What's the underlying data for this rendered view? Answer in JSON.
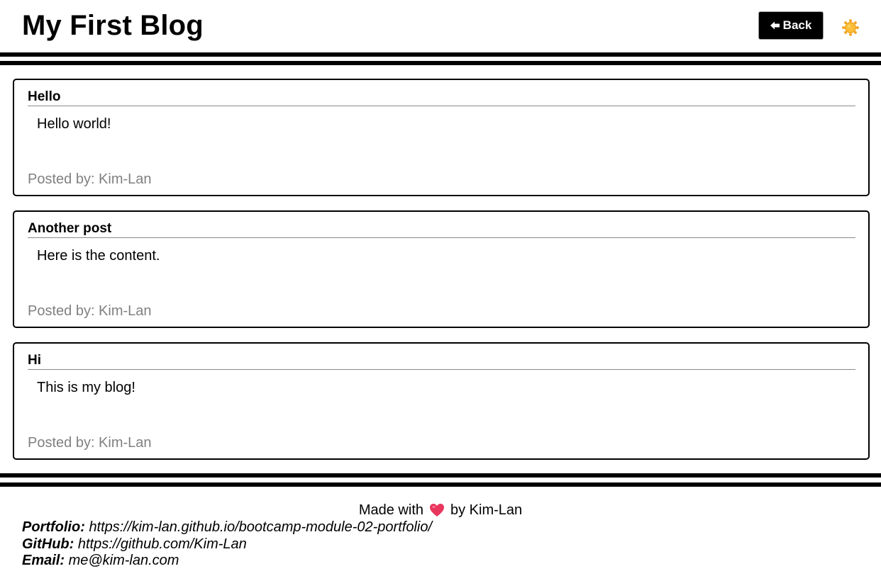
{
  "header": {
    "title": "My First Blog",
    "back_label": "Back",
    "theme_icon": "sun-icon"
  },
  "posts": [
    {
      "title": "Hello",
      "content": "Hello world!",
      "author": "Posted by: Kim-Lan"
    },
    {
      "title": "Another post",
      "content": "Here is the content.",
      "author": "Posted by: Kim-Lan"
    },
    {
      "title": "Hi",
      "content": "This is my blog!",
      "author": "Posted by: Kim-Lan"
    }
  ],
  "footer": {
    "made_prefix": "Made with",
    "made_suffix": "by Kim-Lan",
    "heart_icon": "heart-icon",
    "links": [
      {
        "label": "Portfolio:",
        "value": "https://kim-lan.github.io/bootcamp-module-02-portfolio/"
      },
      {
        "label": "GitHub:",
        "value": "https://github.com/Kim-Lan"
      },
      {
        "label": "Email:",
        "value": "me@kim-lan.com"
      }
    ]
  },
  "colors": {
    "text": "#000000",
    "background": "#ffffff",
    "muted": "#808080",
    "sun": "#f5a623",
    "heart": "#e8365d"
  }
}
